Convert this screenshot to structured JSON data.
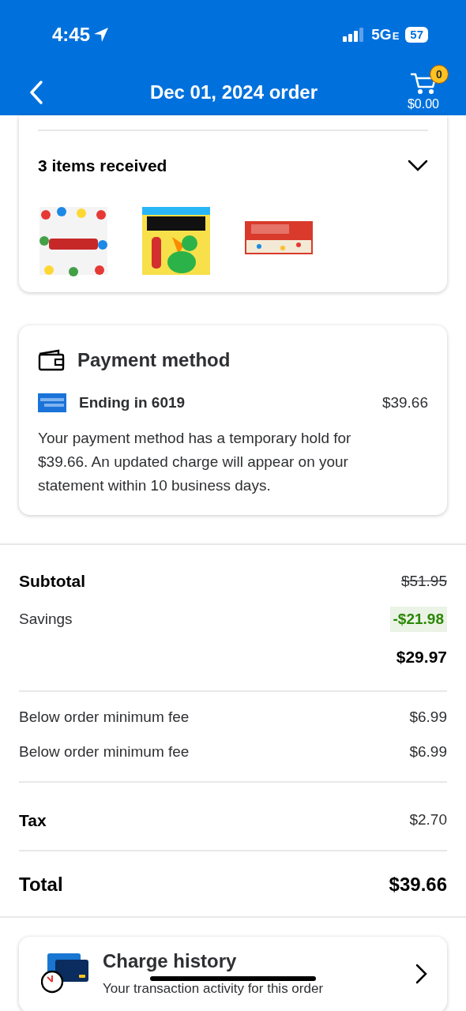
{
  "status_bar": {
    "time": "4:45",
    "network": "5G",
    "network_suffix": "E",
    "battery": "57"
  },
  "header": {
    "title": "Dec 01, 2024 order",
    "cart_count": "0",
    "cart_total": "$0.00"
  },
  "items_card": {
    "title": "3 items received"
  },
  "payment": {
    "title": "Payment method",
    "card_label": "Ending in 6019",
    "amount": "$39.66",
    "note": "Your payment method has a temporary hold for $39.66. An updated charge will appear on your statement within 10 business days."
  },
  "summary": [
    {
      "rows": [
        {
          "kind": "bold",
          "label": "Subtotal",
          "value": "$51.95",
          "struck": true
        },
        {
          "kind": "savings",
          "label": "Savings",
          "value": "-$21.98"
        },
        {
          "kind": "result",
          "value": "$29.97"
        }
      ]
    },
    {
      "rows": [
        {
          "kind": "plain",
          "label": "Below order minimum fee",
          "value": "$6.99"
        },
        {
          "kind": "plain",
          "label": "Below order minimum fee",
          "value": "$6.99"
        }
      ]
    },
    {
      "rows": [
        {
          "kind": "bold",
          "label": "Tax",
          "value": "$2.70",
          "struck": false
        }
      ]
    },
    {
      "rows": [
        {
          "kind": "total",
          "label": "Total",
          "value": "$39.66"
        }
      ]
    }
  ],
  "charge_history": {
    "title": "Charge history",
    "subtitle": "Your transaction activity for this order"
  }
}
